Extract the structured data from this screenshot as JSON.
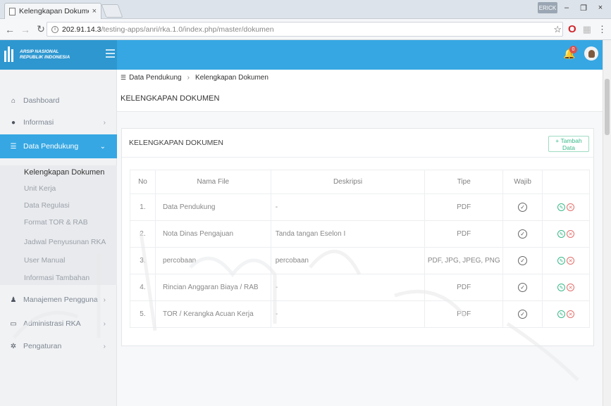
{
  "browser": {
    "tab_title": "Kelengkapan Dokumen",
    "tab_close": "×",
    "url_host": "202.91.14.3",
    "url_path": "/testing-apps/anri/rka.1.0/index.php/master/dokumen",
    "user_chip": "ERICK",
    "win_min": "–",
    "win_max": "❐",
    "win_close": "×"
  },
  "brand": {
    "line1": "ARSIP NASIONAL",
    "line2": "REPUBLIK INDONESIA"
  },
  "header": {
    "notif_count": "0"
  },
  "sidebar": {
    "items": [
      {
        "label": "Dashboard",
        "icon": "home-icon",
        "glyph": "⌂"
      },
      {
        "label": "Informasi",
        "icon": "info-icon",
        "glyph": "❶"
      },
      {
        "label": "Data Pendukung",
        "icon": "list-icon",
        "glyph": "☰"
      },
      {
        "label": "Manajemen Pengguna",
        "icon": "user-icon",
        "glyph": "♟"
      },
      {
        "label": "Administrasi RKA",
        "icon": "folder-icon",
        "glyph": "▭"
      },
      {
        "label": "Pengaturan",
        "icon": "gear-icon",
        "glyph": "✲"
      }
    ],
    "subitems": [
      "Kelengkapan Dokumen",
      "Unit Kerja",
      "Data Regulasi",
      "Format TOR & RAB",
      "Jadwal Penyusunan RKA",
      "User Manual",
      "Informasi Tambahan"
    ]
  },
  "breadcrumb": {
    "parent": "Data Pendukung",
    "current": "Kelengkapan Dokumen"
  },
  "page_title": "KELENGKAPAN DOKUMEN",
  "panel": {
    "title": "KELENGKAPAN DOKUMEN",
    "add_label": "+ Tambah Data"
  },
  "table": {
    "headers": {
      "no": "No",
      "file": "Nama File",
      "desc": "Deskripsi",
      "type": "Tipe",
      "required": "Wajib"
    },
    "rows": [
      {
        "no": "1.",
        "file": "Data Pendukung",
        "desc": "-",
        "type": "PDF"
      },
      {
        "no": "2.",
        "file": "Nota Dinas Pengajuan",
        "desc": "Tanda tangan Eselon I",
        "type": "PDF"
      },
      {
        "no": "3.",
        "file": "percobaan",
        "desc": "percobaan",
        "type": "PDF, JPG, JPEG, PNG"
      },
      {
        "no": "4.",
        "file": "Rincian Anggaran Biaya / RAB",
        "desc": "-",
        "type": "PDF"
      },
      {
        "no": "5.",
        "file": "TOR / Kerangka Acuan Kerja",
        "desc": "-",
        "type": "PDF"
      }
    ]
  },
  "colors": {
    "primary": "#36a7e3",
    "success": "#3ab98a",
    "danger": "#e36f6b"
  }
}
